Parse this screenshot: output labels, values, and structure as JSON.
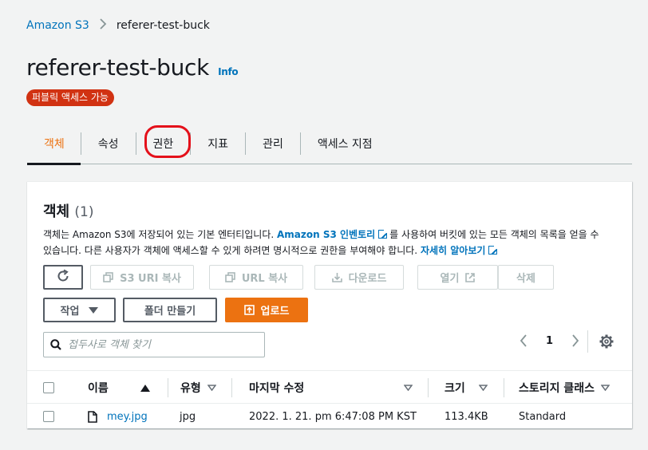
{
  "breadcrumb": {
    "root": "Amazon S3",
    "current": "referer-test-buck"
  },
  "header": {
    "title": "referer-test-buck",
    "info": "Info",
    "badge": "퍼블릭 액세스 가능"
  },
  "tabs": [
    {
      "label": "객체",
      "active": true
    },
    {
      "label": "속성"
    },
    {
      "label": "권한",
      "highlighted": true
    },
    {
      "label": "지표"
    },
    {
      "label": "관리"
    },
    {
      "label": "액세스 지점"
    }
  ],
  "objects": {
    "heading": "객체",
    "count": "(1)",
    "desc_part1": "객체는 Amazon S3에 저장되어 있는 기본 엔터티입니다. ",
    "desc_link1": "Amazon S3 인벤토리",
    "desc_part2": "를 사용하여 버킷에 있는 모든 객체의 목록을 얻을 수 있습니다. 다른 사용자가 객체에 액세스할 수 있게 하려면 명시적으로 권한을 부여해야 합니다. ",
    "desc_link2": "자세히 알아보기",
    "buttons": {
      "copy_s3_uri": "S3 URI 복사",
      "copy_url": "URL 복사",
      "download": "다운로드",
      "open": "열기",
      "delete": "삭제",
      "actions": "작업",
      "create_folder": "폴더 만들기",
      "upload": "업로드"
    },
    "search_placeholder": "접두사로 객체 찾기",
    "pagination": {
      "current_page": "1"
    },
    "columns": [
      "이름",
      "유형",
      "마지막 수정",
      "크기",
      "스토리지 클래스"
    ],
    "rows": [
      {
        "name": "mey.jpg",
        "type": "jpg",
        "last_modified": "2022. 1. 21. pm 6:47:08 PM KST",
        "size": "113.4KB",
        "storage_class": "Standard"
      }
    ]
  },
  "colors": {
    "accent": "#ec7211",
    "link": "#0073bb",
    "badge": "#d13212",
    "highlight_circle": "#e4101a"
  }
}
